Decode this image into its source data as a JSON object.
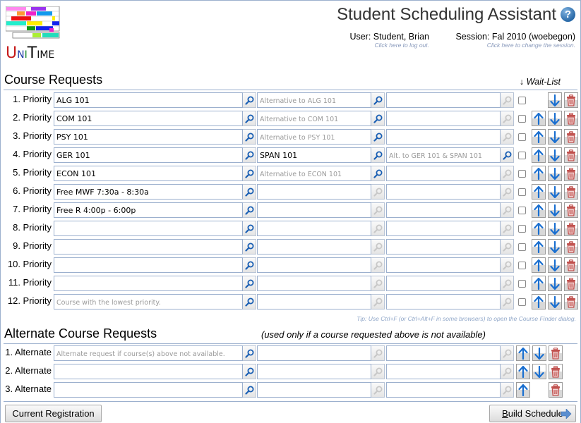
{
  "header": {
    "logo": {
      "text_parts": [
        "U",
        "N",
        "I",
        "T",
        "IME"
      ],
      "colors": [
        "#c61a1a",
        "#1f3da8",
        "#1c8a2b",
        "#111111",
        "#111111"
      ]
    },
    "title": "Student Scheduling Assistant",
    "help_icon": "help-question-icon",
    "user": {
      "label": "User: Student, Brian",
      "link": "Click here to log out."
    },
    "session": {
      "label": "Session: Fal 2010 (woebegon)",
      "link": "Click here to change the session."
    }
  },
  "course_requests": {
    "title": "Course Requests",
    "waitlist_header": "↓ Wait-List",
    "rows": [
      {
        "label": "1. Priority",
        "course": "ALG 101",
        "course_placeholder": "",
        "alt1": "",
        "alt1_placeholder": "Alternative to ALG 101",
        "alt2": "",
        "alt2_placeholder": "",
        "waitlist": false,
        "show_up": false,
        "show_down": true
      },
      {
        "label": "2. Priority",
        "course": "COM 101",
        "course_placeholder": "",
        "alt1": "",
        "alt1_placeholder": "Alternative to COM 101",
        "alt2": "",
        "alt2_placeholder": "",
        "waitlist": false,
        "show_up": true,
        "show_down": true
      },
      {
        "label": "3. Priority",
        "course": "PSY 101",
        "course_placeholder": "",
        "alt1": "",
        "alt1_placeholder": "Alternative to PSY 101",
        "alt2": "",
        "alt2_placeholder": "",
        "waitlist": false,
        "show_up": true,
        "show_down": true
      },
      {
        "label": "4. Priority",
        "course": "GER 101",
        "course_placeholder": "",
        "alt1": "SPAN 101",
        "alt1_placeholder": "",
        "alt2": "",
        "alt2_placeholder": "Alt. to GER 101 & SPAN 101",
        "waitlist": false,
        "show_up": true,
        "show_down": true
      },
      {
        "label": "5. Priority",
        "course": "ECON 101",
        "course_placeholder": "",
        "alt1": "",
        "alt1_placeholder": "Alternative to ECON 101",
        "alt2": "",
        "alt2_placeholder": "",
        "waitlist": false,
        "show_up": true,
        "show_down": true
      },
      {
        "label": "6. Priority",
        "course": "Free MWF 7:30a - 8:30a",
        "course_placeholder": "",
        "alt1": "",
        "alt1_placeholder": "",
        "alt2": "",
        "alt2_placeholder": "",
        "waitlist": false,
        "show_up": true,
        "show_down": true
      },
      {
        "label": "7. Priority",
        "course": "Free R 4:00p - 6:00p",
        "course_placeholder": "",
        "alt1": "",
        "alt1_placeholder": "",
        "alt2": "",
        "alt2_placeholder": "",
        "waitlist": false,
        "show_up": true,
        "show_down": true
      },
      {
        "label": "8. Priority",
        "course": "",
        "course_placeholder": "",
        "alt1": "",
        "alt1_placeholder": "",
        "alt2": "",
        "alt2_placeholder": "",
        "waitlist": false,
        "show_up": true,
        "show_down": true
      },
      {
        "label": "9. Priority",
        "course": "",
        "course_placeholder": "",
        "alt1": "",
        "alt1_placeholder": "",
        "alt2": "",
        "alt2_placeholder": "",
        "waitlist": false,
        "show_up": true,
        "show_down": true
      },
      {
        "label": "10. Priority",
        "course": "",
        "course_placeholder": "",
        "alt1": "",
        "alt1_placeholder": "",
        "alt2": "",
        "alt2_placeholder": "",
        "waitlist": false,
        "show_up": true,
        "show_down": true
      },
      {
        "label": "11. Priority",
        "course": "",
        "course_placeholder": "",
        "alt1": "",
        "alt1_placeholder": "",
        "alt2": "",
        "alt2_placeholder": "",
        "waitlist": false,
        "show_up": true,
        "show_down": true
      },
      {
        "label": "12. Priority",
        "course": "",
        "course_placeholder": "Course with the lowest priority.",
        "alt1": "",
        "alt1_placeholder": "",
        "alt2": "",
        "alt2_placeholder": "",
        "waitlist": false,
        "show_up": true,
        "show_down": true
      }
    ],
    "tip": "Tip: Use Ctrl+F (or Ctrl+Alt+F in some browsers) to open the Course Finder dialog."
  },
  "alternate_requests": {
    "title": "Alternate Course Requests",
    "note": "(used only if a course requested above is not available)",
    "rows": [
      {
        "label": "1. Alternate",
        "course": "",
        "course_placeholder": "Alternate request if course(s) above not available.",
        "alt1": "",
        "alt2": "",
        "show_up": true,
        "show_down": true
      },
      {
        "label": "2. Alternate",
        "course": "",
        "course_placeholder": "",
        "alt1": "",
        "alt2": "",
        "show_up": true,
        "show_down": true
      },
      {
        "label": "3. Alternate",
        "course": "",
        "course_placeholder": "",
        "alt1": "",
        "alt2": "",
        "show_up": true,
        "show_down": false
      }
    ]
  },
  "footer": {
    "current_registration": "Current Registration",
    "build_schedule_accel": "B",
    "build_schedule_rest": "uild Schedule"
  },
  "colors": {
    "border": "#9cb0ce",
    "search_active": "#1a5fb4",
    "search_inactive": "#c8c8c8",
    "arrow": "#1a6fd0",
    "trash": "#c0504d",
    "link": "#8899bb"
  }
}
